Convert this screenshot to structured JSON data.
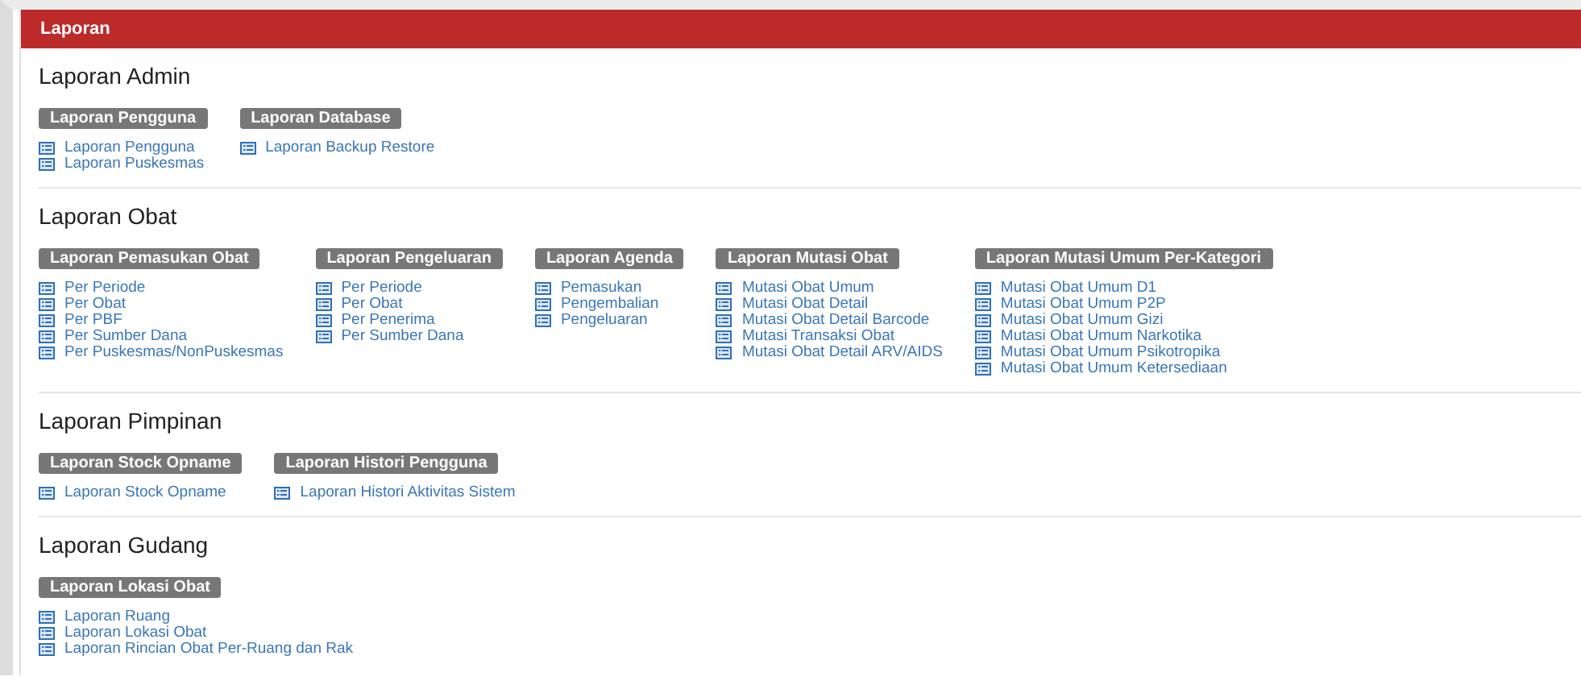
{
  "panel": {
    "title": "Laporan"
  },
  "sections": [
    {
      "title": "Laporan Admin",
      "groups": [
        {
          "title": "Laporan Pengguna",
          "links": [
            "Laporan Pengguna",
            "Laporan Puskesmas"
          ]
        },
        {
          "title": "Laporan Database",
          "links": [
            "Laporan Backup Restore"
          ]
        }
      ]
    },
    {
      "title": "Laporan Obat",
      "groups": [
        {
          "title": "Laporan Pemasukan Obat",
          "links": [
            "Per Periode",
            "Per Obat",
            "Per PBF",
            "Per Sumber Dana",
            "Per Puskesmas/NonPuskesmas"
          ]
        },
        {
          "title": "Laporan Pengeluaran",
          "links": [
            "Per Periode",
            "Per Obat",
            "Per Penerima",
            "Per Sumber Dana"
          ]
        },
        {
          "title": "Laporan Agenda",
          "links": [
            "Pemasukan",
            "Pengembalian",
            "Pengeluaran"
          ]
        },
        {
          "title": "Laporan Mutasi Obat",
          "links": [
            "Mutasi Obat Umum",
            "Mutasi Obat Detail",
            "Mutasi Obat Detail Barcode",
            "Mutasi Transaksi Obat",
            "Mutasi Obat Detail ARV/AIDS"
          ]
        },
        {
          "title": "Laporan Mutasi Umum Per-Kategori",
          "links": [
            "Mutasi Obat Umum D1",
            "Mutasi Obat Umum P2P",
            "Mutasi Obat Umum Gizi",
            "Mutasi Obat Umum Narkotika",
            "Mutasi Obat Umum Psikotropika",
            "Mutasi Obat Umum Ketersediaan"
          ]
        }
      ]
    },
    {
      "title": "Laporan Pimpinan",
      "groups": [
        {
          "title": "Laporan Stock Opname",
          "links": [
            "Laporan Stock Opname"
          ]
        },
        {
          "title": "Laporan Histori Pengguna",
          "links": [
            "Laporan Histori Aktivitas Sistem"
          ]
        }
      ]
    },
    {
      "title": "Laporan Gudang",
      "groups": [
        {
          "title": "Laporan Lokasi Obat",
          "links": [
            "Laporan Ruang",
            "Laporan Lokasi Obat",
            "Laporan Rincian Obat Per-Ruang dan Rak"
          ]
        }
      ]
    }
  ]
}
